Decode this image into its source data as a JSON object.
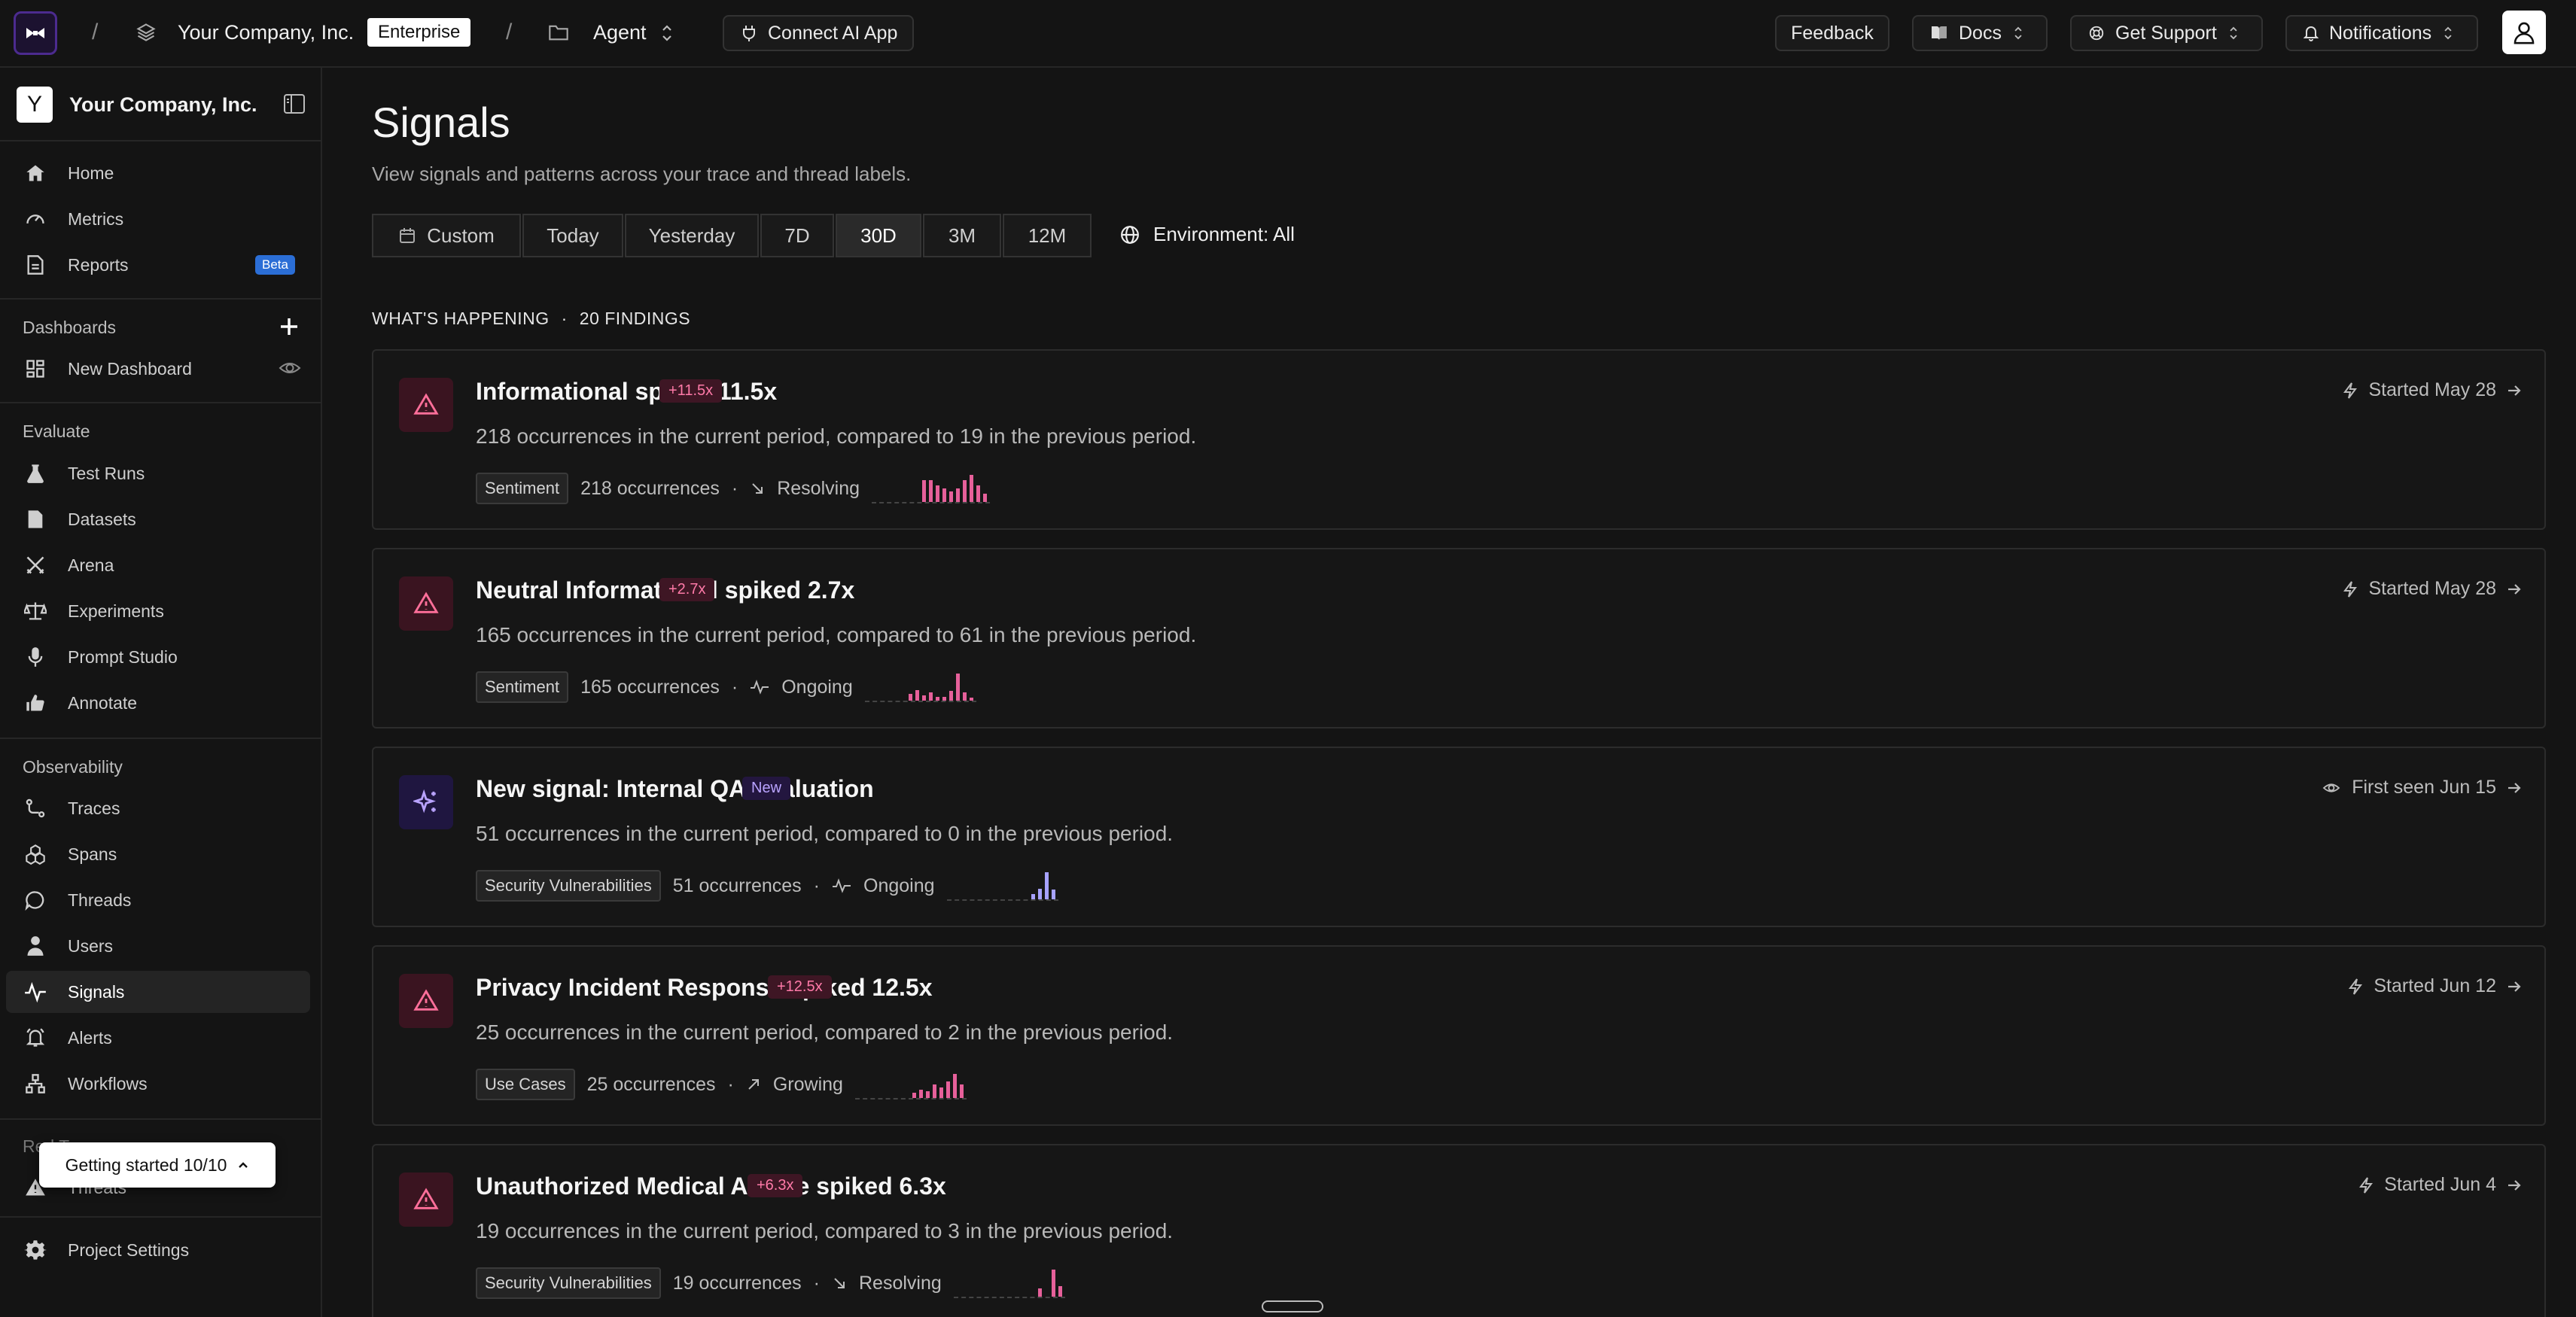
{
  "topbar": {
    "org": "Your Company, Inc.",
    "plan_badge": "Enterprise",
    "project": "Agent",
    "connect": "Connect AI App",
    "feedback": "Feedback",
    "docs": "Docs",
    "support": "Get Support",
    "notifications": "Notifications"
  },
  "sidebar": {
    "org_initial": "Y",
    "org_name": "Your Company, Inc.",
    "top_items": [
      {
        "label": "Home",
        "icon": "home-icon"
      },
      {
        "label": "Metrics",
        "icon": "gauge-icon"
      },
      {
        "label": "Reports",
        "icon": "document-icon",
        "badge": "Beta"
      }
    ],
    "dashboards_title": "Dashboards",
    "dashboard_item": "New Dashboard",
    "evaluate_title": "Evaluate",
    "evaluate_items": [
      "Test Runs",
      "Datasets",
      "Arena",
      "Experiments",
      "Prompt Studio",
      "Annotate"
    ],
    "observability_title": "Observability",
    "observability_items": [
      "Traces",
      "Spans",
      "Threads",
      "Users",
      "Signals",
      "Alerts",
      "Workflows"
    ],
    "red_team_title": "Red Team",
    "red_team_item": "Threats",
    "settings": "Project Settings",
    "getting_started": "Getting started 10/10"
  },
  "main": {
    "title": "Signals",
    "subtitle": "View signals and patterns across your trace and thread labels.",
    "filters": [
      "Custom",
      "Today",
      "Yesterday",
      "7D",
      "30D",
      "3M",
      "12M"
    ],
    "active_filter": "30D",
    "environment": "Environment: All",
    "section_label": "WHAT'S HAPPENING",
    "findings_count": "20 FINDINGS"
  },
  "findings": [
    {
      "kind": "spike",
      "title": "Informational spiked 11.5x",
      "badge": "+11.5x",
      "desc": "218 occurrences in the current period, compared to 19 in the previous period.",
      "tag": "Sentiment",
      "count": "218 occurrences",
      "status": "Resolving",
      "right": "Started May 28",
      "bars": [
        0,
        0,
        0,
        0,
        0,
        0,
        0,
        0.8,
        0.8,
        0.6,
        0.5,
        0.4,
        0.5,
        0.8,
        1.0,
        0.6,
        0.3
      ],
      "color": "#e6609a"
    },
    {
      "kind": "spike",
      "title": "Neutral Informational spiked 2.7x",
      "badge": "+2.7x",
      "desc": "165 occurrences in the current period, compared to 61 in the previous period.",
      "tag": "Sentiment",
      "count": "165 occurrences",
      "status": "Ongoing",
      "right": "Started May 28",
      "bars": [
        0,
        0,
        0,
        0,
        0,
        0,
        0.25,
        0.4,
        0.2,
        0.3,
        0.15,
        0.15,
        0.35,
        1.0,
        0.3,
        0.1
      ],
      "color": "#e6609a"
    },
    {
      "kind": "new",
      "title": "New signal: Internal QA Evaluation",
      "badge": "New",
      "desc": "51 occurrences in the current period, compared to 0 in the previous period.",
      "tag": "Security Vulnerabilities",
      "count": "51 occurrences",
      "status": "Ongoing",
      "right": "First seen Jun 15",
      "bars": [
        0,
        0,
        0,
        0,
        0,
        0,
        0,
        0,
        0,
        0,
        0,
        0,
        0.2,
        0.4,
        1.0,
        0.35
      ],
      "color": "#a7a2ff"
    },
    {
      "kind": "spike",
      "title": "Privacy Incident Response spiked 12.5x",
      "badge": "+12.5x",
      "desc": "25 occurrences in the current period, compared to 2 in the previous period.",
      "tag": "Use Cases",
      "count": "25 occurrences",
      "status": "Growing",
      "right": "Started Jun 12",
      "bars": [
        0,
        0,
        0,
        0,
        0,
        0,
        0,
        0,
        0.2,
        0.3,
        0.25,
        0.5,
        0.4,
        0.6,
        0.9,
        0.5
      ],
      "color": "#e6609a"
    },
    {
      "kind": "spike",
      "title": "Unauthorized Medical Advice spiked 6.3x",
      "badge": "+6.3x",
      "desc": "19 occurrences in the current period, compared to 3 in the previous period.",
      "tag": "Security Vulnerabilities",
      "count": "19 occurrences",
      "status": "Resolving",
      "right": "Started Jun 4",
      "bars": [
        0,
        0,
        0,
        0,
        0,
        0,
        0,
        0,
        0,
        0,
        0,
        0,
        0.3,
        0.0,
        1.0,
        0.4
      ],
      "color": "#e6609a"
    }
  ]
}
